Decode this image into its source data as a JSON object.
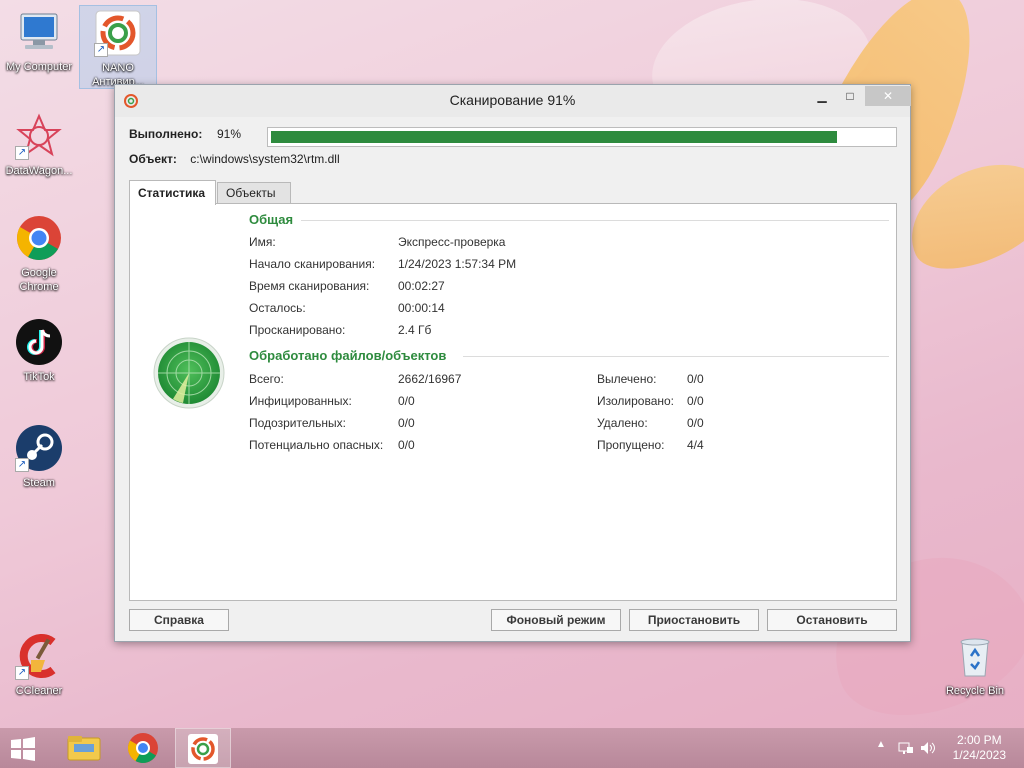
{
  "desktop": {
    "icons": [
      {
        "label": "My Computer"
      },
      {
        "label": "NANO\nАнтивир..."
      },
      {
        "label": "DataWagon..."
      },
      {
        "label": "Google\nChrome"
      },
      {
        "label": "TikTok"
      },
      {
        "label": "Steam"
      },
      {
        "label": "CCleaner"
      },
      {
        "label": "Recycle Bin"
      }
    ]
  },
  "window": {
    "title": "Сканирование 91%",
    "controls": {
      "minimize": "▁",
      "maximize": "□",
      "close": "✕"
    },
    "progress": {
      "label": "Выполнено:",
      "percent_text": "91%",
      "value": 0.91
    },
    "object": {
      "label": "Объект:",
      "value": "c:\\windows\\system32\\rtm.dll"
    },
    "tabs": [
      {
        "label": "Статистика",
        "active": true
      },
      {
        "label": "Объекты",
        "active": false
      }
    ],
    "general": {
      "heading": "Общая",
      "rows": [
        {
          "key": "Имя:",
          "value": "Экспресс-проверка"
        },
        {
          "key": "Начало сканирования:",
          "value": "1/24/2023 1:57:34 PM"
        },
        {
          "key": "Время сканирования:",
          "value": "00:02:27"
        },
        {
          "key": "Осталось:",
          "value": "00:00:14"
        },
        {
          "key": "Просканировано:",
          "value": "2.4 Гб"
        }
      ]
    },
    "processed": {
      "heading": "Обработано файлов/объектов",
      "left": [
        {
          "key": "Всего:",
          "value": "2662/16967"
        },
        {
          "key": "Инфицированных:",
          "value": "0/0"
        },
        {
          "key": "Подозрительных:",
          "value": "0/0"
        },
        {
          "key": "Потенциально опасных:",
          "value": "0/0"
        }
      ],
      "right": [
        {
          "key": "Вылечено:",
          "value": "0/0"
        },
        {
          "key": "Изолировано:",
          "value": "0/0"
        },
        {
          "key": "Удалено:",
          "value": "0/0"
        },
        {
          "key": "Пропущено:",
          "value": "4/4"
        }
      ]
    },
    "buttons": {
      "help": "Справка",
      "background": "Фоновый режим",
      "pause": "Приостановить",
      "stop": "Остановить"
    }
  },
  "taskbar": {
    "clock_time": "2:00 PM",
    "clock_date": "1/24/2023",
    "tray_arrow": "▲"
  },
  "colors": {
    "accent_green": "#2e8b3e"
  }
}
